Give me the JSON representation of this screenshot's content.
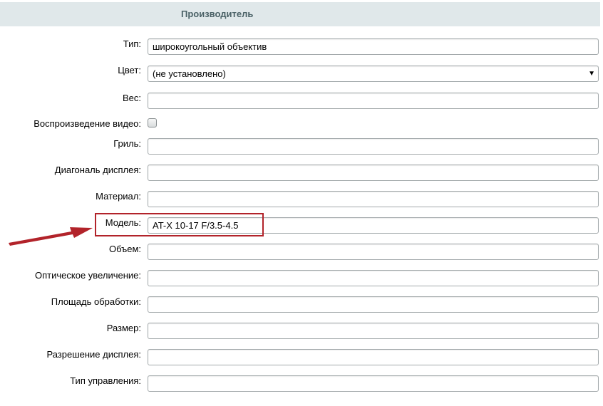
{
  "section": {
    "title": "Производитель"
  },
  "fields": {
    "type": {
      "label": "Тип:",
      "value": "широкоугольный объектив"
    },
    "color": {
      "label": "Цвет:",
      "value": "(не установлено)"
    },
    "weight": {
      "label": "Вес:",
      "value": ""
    },
    "video": {
      "label": "Воспроизведение видео:",
      "checked": false
    },
    "grill": {
      "label": "Гриль:",
      "value": ""
    },
    "diagonal": {
      "label": "Диагональ дисплея:",
      "value": ""
    },
    "material": {
      "label": "Материал:",
      "value": ""
    },
    "model": {
      "label": "Модель:",
      "value": "AT-X 10-17 F/3.5-4.5"
    },
    "volume": {
      "label": "Объем:",
      "value": ""
    },
    "optical_zoom": {
      "label": "Оптическое увеличение:",
      "value": ""
    },
    "area": {
      "label": "Площадь обработки:",
      "value": ""
    },
    "size": {
      "label": "Размер:",
      "value": ""
    },
    "resolution": {
      "label": "Разрешение дисплея:",
      "value": ""
    },
    "control_type": {
      "label": "Тип управления:",
      "value": ""
    }
  },
  "annotation": {
    "highlight_color": "#b2232a",
    "arrow_color": "#b2232a"
  }
}
